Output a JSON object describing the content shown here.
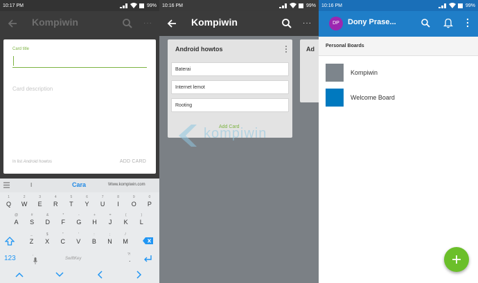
{
  "panel_left": {
    "status": {
      "time": "10:17 PM",
      "battery": "99%"
    },
    "appbar": {
      "title": "Kompiwin"
    },
    "dialog": {
      "title_label": "Card title",
      "title_value": "",
      "description_placeholder": "Card description",
      "list_info_prefix": "In list ",
      "list_info_name": "Android howtos",
      "add_card_button": "ADD CARD"
    },
    "keyboard": {
      "suggestions": [
        "I",
        "Cara",
        "Www.kompiwin.com"
      ],
      "row1": [
        {
          "main": "Q",
          "sub": "1"
        },
        {
          "main": "W",
          "sub": "2"
        },
        {
          "main": "E",
          "sub": "3"
        },
        {
          "main": "R",
          "sub": "4"
        },
        {
          "main": "T",
          "sub": "5"
        },
        {
          "main": "Y",
          "sub": "6"
        },
        {
          "main": "U",
          "sub": "7"
        },
        {
          "main": "I",
          "sub": "8"
        },
        {
          "main": "O",
          "sub": "9"
        },
        {
          "main": "P",
          "sub": "0"
        }
      ],
      "row2": [
        {
          "main": "A",
          "sub": "@"
        },
        {
          "main": "S",
          "sub": "#"
        },
        {
          "main": "D",
          "sub": "&"
        },
        {
          "main": "F",
          "sub": "*"
        },
        {
          "main": "G",
          "sub": "-"
        },
        {
          "main": "H",
          "sub": "+"
        },
        {
          "main": "J",
          "sub": "="
        },
        {
          "main": "K",
          "sub": "("
        },
        {
          "main": "L",
          "sub": ")"
        }
      ],
      "row3": [
        {
          "main": "Z",
          "sub": "_"
        },
        {
          "main": "X",
          "sub": "$"
        },
        {
          "main": "C",
          "sub": "\""
        },
        {
          "main": "V",
          "sub": "'"
        },
        {
          "main": "B",
          "sub": ":"
        },
        {
          "main": "N",
          "sub": ";"
        },
        {
          "main": "M",
          "sub": "/"
        }
      ],
      "row4": {
        "num_key": "123",
        "space_brand": "SwiftKey",
        "comma_sub": ",",
        "period_sub": "?!",
        "period": "."
      }
    }
  },
  "panel_middle": {
    "status": {
      "time": "10:16 PM",
      "battery": "99%"
    },
    "appbar": {
      "title": "Kompiwin"
    },
    "list": {
      "title": "Android howtos",
      "cards": [
        "Baterai",
        "Internet lemot",
        "Rooting"
      ],
      "add_card": "Add Card"
    },
    "next_list_title": "Ad",
    "watermark": "kompiwin"
  },
  "panel_right": {
    "status": {
      "time": "10:16 PM",
      "battery": "99%"
    },
    "appbar": {
      "avatar_initials": "DP",
      "title": "Dony Prase..."
    },
    "section_title": "Personal Boards",
    "boards": [
      {
        "name": "Kompiwin",
        "color": "#7d858c"
      },
      {
        "name": "Welcome Board",
        "color": "#0079bf"
      }
    ],
    "fab_icon": "plus-icon"
  },
  "colors": {
    "trello_blue": "#1f7ec8",
    "accent_green": "#7cb342",
    "fab_green": "#6bbf2a",
    "dark_appbar": "#3b3b3b"
  }
}
